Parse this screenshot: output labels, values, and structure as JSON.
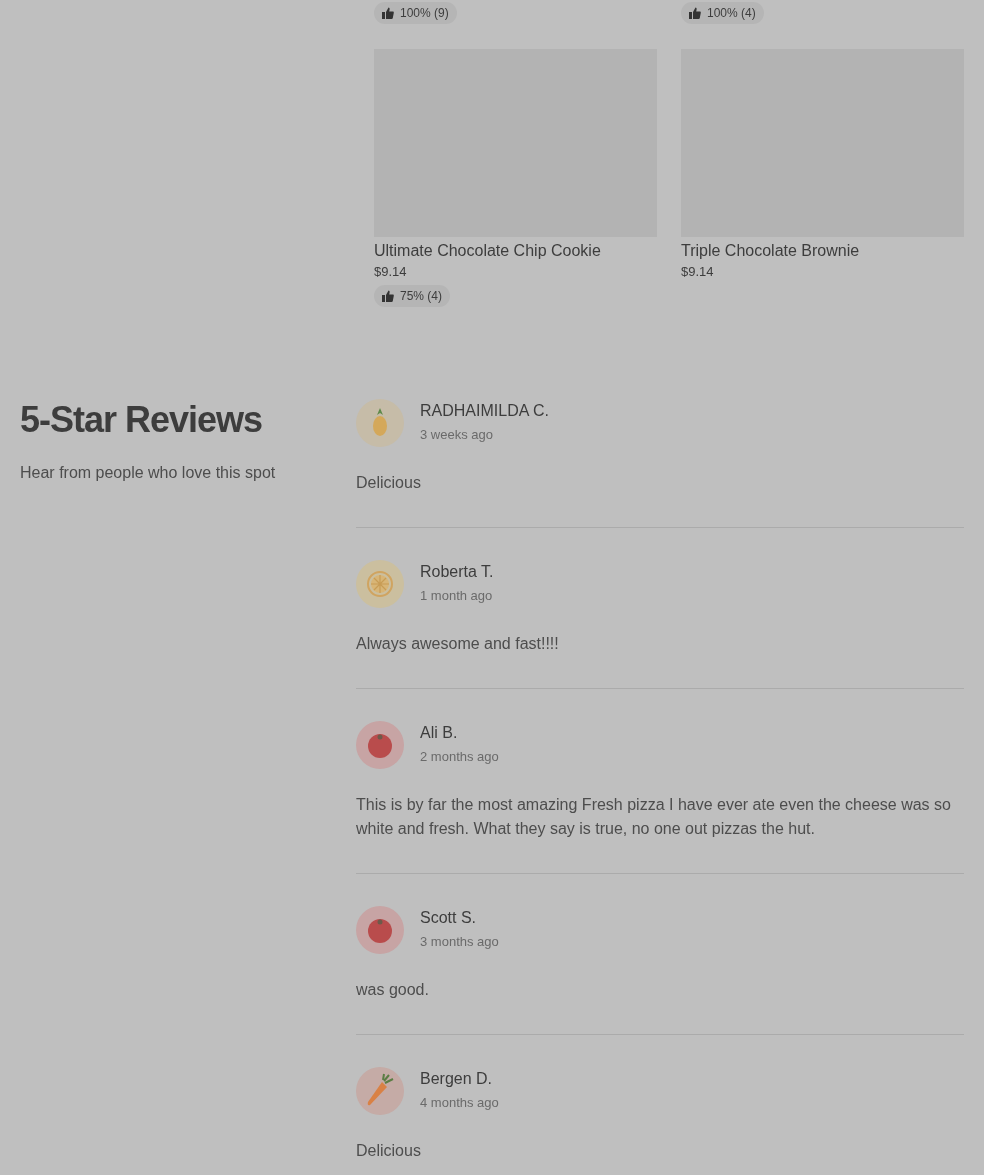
{
  "top_products": [
    {
      "rating": "100% (9)"
    },
    {
      "rating": "100% (4)"
    }
  ],
  "products": [
    {
      "name": "Ultimate Chocolate Chip Cookie",
      "price": "$9.14",
      "rating": "75% (4)"
    },
    {
      "name": "Triple Chocolate Brownie",
      "price": "$9.14"
    }
  ],
  "reviews_section": {
    "title": "5-Star Reviews",
    "subtitle": "Hear from people who love this spot"
  },
  "reviews": [
    {
      "kind": "pineapple",
      "name": "RADHAIMILDA C.",
      "time": "3 weeks ago",
      "text": "Delicious"
    },
    {
      "kind": "lemon",
      "name": "Roberta T.",
      "time": "1 month ago",
      "text": "Always awesome and fast!!!!"
    },
    {
      "kind": "tomato",
      "name": "Ali B.",
      "time": "2 months ago",
      "text": "This is by far the most amazing Fresh pizza I have ever ate even the cheese was so white and fresh. What they say is true, no one out pizzas the hut."
    },
    {
      "kind": "tomato",
      "name": "Scott S.",
      "time": "3 months ago",
      "text": "was good."
    },
    {
      "kind": "carrot",
      "name": "Bergen D.",
      "time": "4 months ago",
      "text": "Delicious"
    }
  ]
}
